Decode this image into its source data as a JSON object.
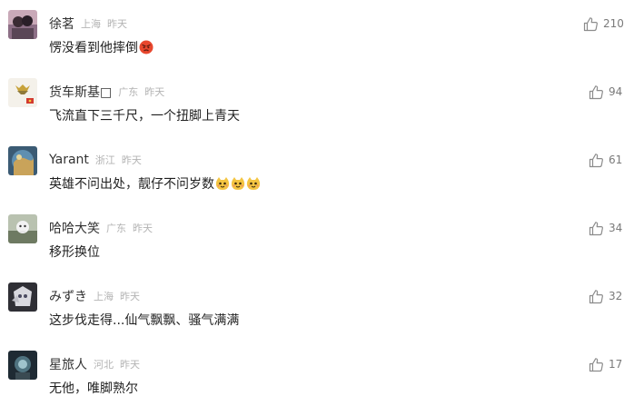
{
  "comments": [
    {
      "username": "徐茗",
      "location": "上海",
      "time": "昨天",
      "content": "愣没看到他摔倒",
      "emoji": [
        "angry-face"
      ],
      "likes": "210"
    },
    {
      "username": "货车斯基□",
      "location": "广东",
      "time": "昨天",
      "content": "飞流直下三千尺，一个扭脚上青天",
      "emoji": [],
      "likes": "94"
    },
    {
      "username": "Yarant",
      "location": "浙江",
      "time": "昨天",
      "content": "英雄不问出处，靓仔不问岁数",
      "emoji": [
        "cat-face",
        "cat-face",
        "cat-face"
      ],
      "likes": "61"
    },
    {
      "username": "哈哈大笑",
      "location": "广东",
      "time": "昨天",
      "content": "移形换位",
      "emoji": [],
      "likes": "34"
    },
    {
      "username": "みずき",
      "location": "上海",
      "time": "昨天",
      "content": "这步伐走得...仙气飘飘、骚气满满",
      "emoji": [],
      "likes": "32"
    },
    {
      "username": "星旅人",
      "location": "河北",
      "time": "昨天",
      "content": "无他，唯脚熟尔",
      "emoji": [],
      "likes": "17"
    }
  ],
  "colors": {
    "username": "#333333",
    "meta": "#b3b3b3",
    "content": "#1f1f1f",
    "like_count": "#7a7a7a",
    "like_icon": "#8c8c8c"
  },
  "icons": {
    "like": "thumbs-up-icon",
    "emoji_angry": "angry-face-emoji",
    "emoji_cat": "cat-face-emoji"
  }
}
